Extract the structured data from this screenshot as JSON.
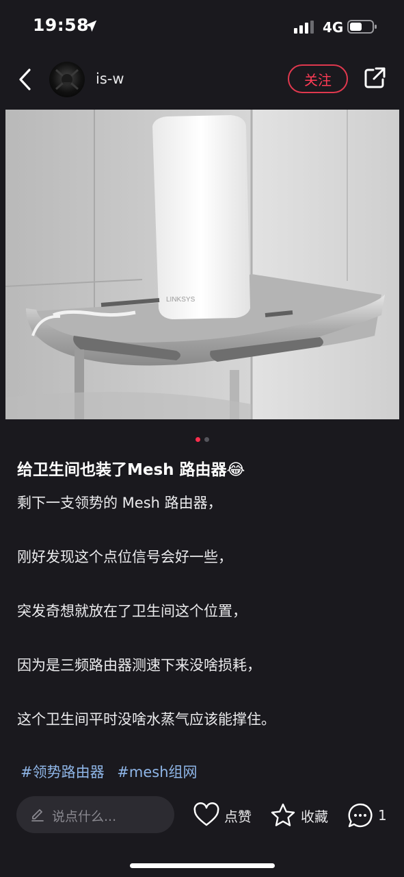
{
  "status_bar": {
    "time": "19:58",
    "network": "4G"
  },
  "header": {
    "username": "is-w",
    "follow_label": "关注"
  },
  "photo": {
    "brand_text": "LINKSYS"
  },
  "carousel": {
    "count": 2,
    "active_index": 0
  },
  "post": {
    "title": "给卫生间也装了Mesh 路由器😂",
    "lines": [
      "剩下一支领势的 Mesh 路由器，",
      "刚好发现这个点位信号会好一些，",
      "突发奇想就放在了卫生间这个位置，",
      "因为是三频路由器测速下来没啥损耗，",
      "这个卫生间平时没啥水蒸气应该能撑住。"
    ],
    "tags": [
      "#领势路由器",
      "#mesh组网"
    ]
  },
  "bottom_bar": {
    "comment_placeholder": "说点什么...",
    "like_label": "点赞",
    "collect_label": "收藏",
    "comment_count": "1"
  },
  "colors": {
    "accent": "#ff2e4d",
    "tag": "#8fb6e8",
    "background": "#1a191e"
  }
}
